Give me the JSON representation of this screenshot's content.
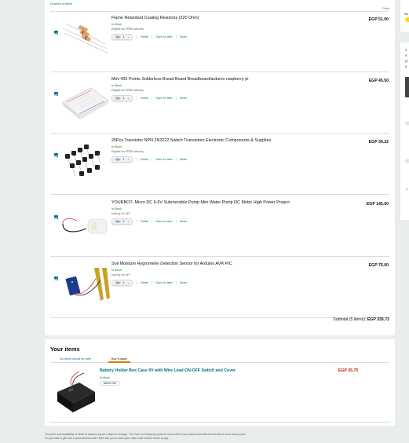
{
  "cart": {
    "deselect_label": "Deselect all items",
    "price_header": "Price",
    "items": [
      {
        "title": "Flame Retardant Coating Resistors (220 Ohm)",
        "stock": "In Stock",
        "sub": "Eligible for FREE delivery",
        "qty_label": "Qty:",
        "qty_value": "1",
        "price": "EGP 51.00",
        "delete_label": "Delete",
        "save_label": "Save for later",
        "share_label": "Share",
        "icon": "resistors-image"
      },
      {
        "title": "Mini 400 Points Solderless Bread Board Breadboard/arduino raspberry pi",
        "stock": "In Stock",
        "sub": "Eligible for FREE delivery",
        "qty_label": "Qty:",
        "qty_value": "1",
        "price": "EGP 45.50",
        "delete_label": "Delete",
        "save_label": "Save for later",
        "share_label": "Share",
        "icon": "breadboard-image"
      },
      {
        "title": "20Pcs Transistor NPN 2N2222 Switch Transistors Electronic Components & Supplies",
        "stock": "In Stock",
        "sub": "Eligible for FREE delivery",
        "qty_label": "Qty:",
        "qty_value": "1",
        "price": "EGP 39.22",
        "delete_label": "Delete",
        "save_label": "Save for later",
        "share_label": "Share",
        "icon": "transistors-image"
      },
      {
        "title": "YOURBOT- Micro DC 6-9V Submersible Pump Mini Water Pump DC Motor High Power Project",
        "stock": "In Stock",
        "sub": "sold by: Ai-LiFt",
        "qty_label": "Qty:",
        "qty_value": "1",
        "price": "EGP 145.00",
        "delete_label": "Delete",
        "save_label": "Save for later",
        "share_label": "Share",
        "icon": "water-pump-image"
      },
      {
        "title": "Soil Moisture Hygrometer Detection Sensor for Arduino AVR PIC",
        "stock": "In Stock",
        "sub": "sold by: Ai-LiFt",
        "qty_label": "Qty:",
        "qty_value": "1",
        "price": "EGP 75.00",
        "delete_label": "Delete",
        "save_label": "Save for later",
        "share_label": "Share",
        "icon": "soil-sensor-image"
      }
    ],
    "subtotal_label": "Subtotal (5 items):",
    "subtotal_value": "EGP 335.72"
  },
  "your_items": {
    "heading": "Your items",
    "tab_saved": "No items saved for later",
    "tab_buy_again": "Buy it again",
    "saved": {
      "title": "Battery Holder Box Case 9V with Wire Lead ON-OFF Switch and Cover",
      "stock": "In Stock",
      "add_label": "Add to Cart",
      "price": "EGP 35.75"
    }
  },
  "footer": {
    "line1": "The price and availability of items at amazon.eg are subject to change. The Cart is a temporary place to store a list of your items and reflects each item's most recent price.",
    "line2": "Do you have a gift card or promotional code? We'll ask you to enter your claim code when it's time to pay."
  },
  "right_panel": {
    "s_label": "Su",
    "c_label": "C",
    "r_label": "R",
    "paren_label": "(2",
    "it_label": "it"
  },
  "colors": {
    "link": "#007185",
    "in_stock": "#007600",
    "price_red": "#b12704",
    "accent": "#e77600",
    "button_yellow": "#ffd814"
  }
}
